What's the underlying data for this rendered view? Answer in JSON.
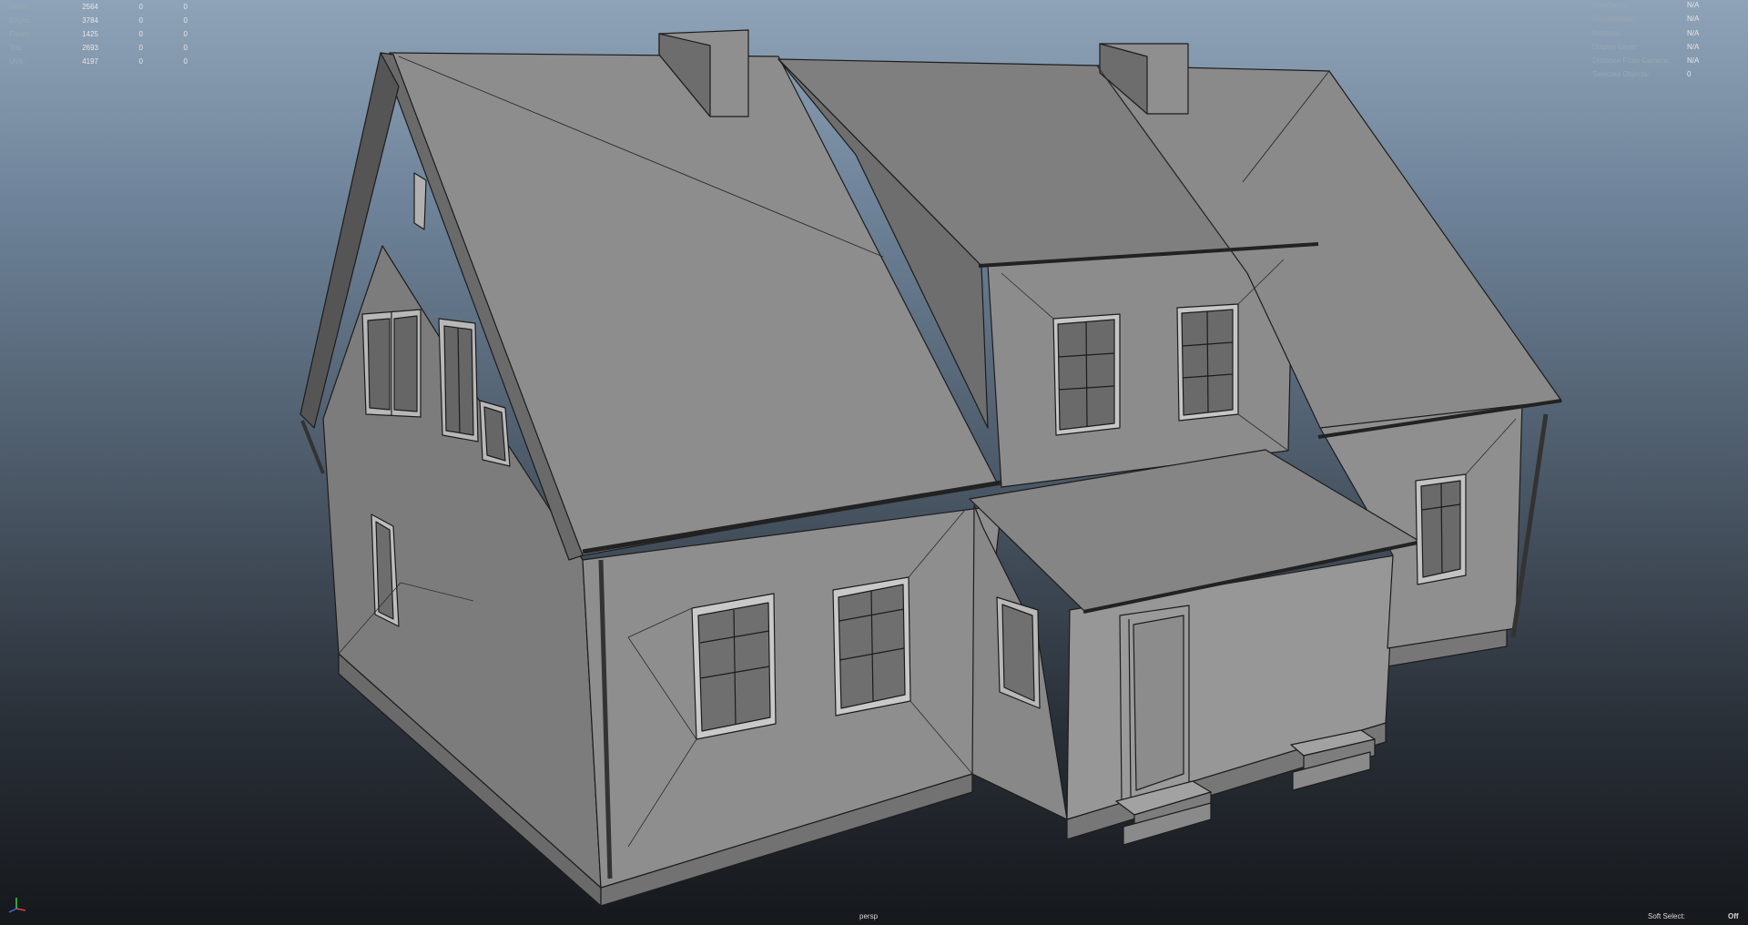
{
  "viewport": {
    "camera": "persp",
    "heads_up_left": [
      {
        "label": "Verts:",
        "v1": "2564",
        "v2": "0",
        "v3": "0"
      },
      {
        "label": "Edges:",
        "v1": "3784",
        "v2": "0",
        "v3": "0"
      },
      {
        "label": "Faces:",
        "v1": "1425",
        "v2": "0",
        "v3": "0"
      },
      {
        "label": "Tris:",
        "v1": "2693",
        "v2": "0",
        "v3": "0"
      },
      {
        "label": "UVs:",
        "v1": "4197",
        "v2": "0",
        "v3": "0"
      }
    ],
    "heads_up_right": [
      {
        "label": "Backfaces:",
        "value": "N/A"
      },
      {
        "label": "Smoothness:",
        "value": "N/A"
      },
      {
        "label": "Instance:",
        "value": "N/A"
      },
      {
        "label": "Display Layer:",
        "value": "N/A"
      },
      {
        "label": "Distance From Camera:",
        "value": "N/A"
      },
      {
        "label": "Selected Objects:",
        "value": "0"
      }
    ],
    "soft_select": {
      "label": "Soft Select:",
      "value": "Off"
    },
    "colors": {
      "model_fill": "#8a8a8a",
      "model_dark": "#5e5e5e",
      "wire": "#1c1c1c",
      "axis_x": "#e23b3b",
      "axis_y": "#3bd14a",
      "axis_z": "#3b6be2"
    },
    "icons": [
      "view-axis-icon"
    ]
  }
}
